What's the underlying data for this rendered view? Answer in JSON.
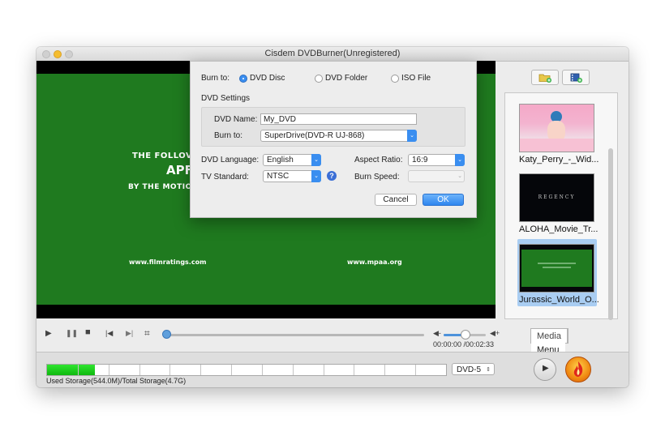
{
  "window": {
    "title": "Cisdem DVDBurner(Unregistered)"
  },
  "video": {
    "line1": "THE FOLLOV",
    "line2": "APF",
    "line3": "BY THE MOTIO",
    "left_url": "www.filmratings.com",
    "right_url": "www.mpaa.org"
  },
  "toolbar": {
    "add_folder_icon": "folder-add-icon",
    "add_video_icon": "film-add-icon"
  },
  "media_list": {
    "items": [
      {
        "label": "Katy_Perry_-_Wid...",
        "selected": false
      },
      {
        "label": "ALOHA_Movie_Tr...",
        "thumb_text": "REGENCY",
        "selected": false
      },
      {
        "label": "Jurassic_World_O...",
        "selected": true
      }
    ]
  },
  "player": {
    "time": "00:00:00 /00:02:33",
    "progress": 0,
    "volume": 0.55
  },
  "tabs": {
    "media": "Media",
    "menu": "Menu"
  },
  "storage": {
    "label": "Used Storage(544.0M)/Total Storage(4.7G)",
    "disc_type": "DVD-5",
    "used_fraction": 0.12
  },
  "dialog": {
    "burn_to_label": "Burn to:",
    "options": {
      "disc": "DVD Disc",
      "folder": "DVD Folder",
      "iso": "ISO File",
      "selected": "disc"
    },
    "settings_header": "DVD Settings",
    "dvd_name_label": "DVD Name:",
    "dvd_name_value": "My_DVD",
    "burn_to_device_label": "Burn to:",
    "burn_to_device_value": "SuperDrive(DVD-R   UJ-868)",
    "language_label": "DVD Language:",
    "language_value": "English",
    "aspect_label": "Aspect Ratio:",
    "aspect_value": "16:9",
    "tv_label": "TV Standard:",
    "tv_value": "NTSC",
    "speed_label": "Burn Speed:",
    "speed_value": "",
    "help": "?",
    "cancel": "Cancel",
    "ok": "OK"
  },
  "colors": {
    "accent": "#3a8ef0",
    "video_green": "#1f7a1f",
    "storage_green": "#22d022"
  }
}
